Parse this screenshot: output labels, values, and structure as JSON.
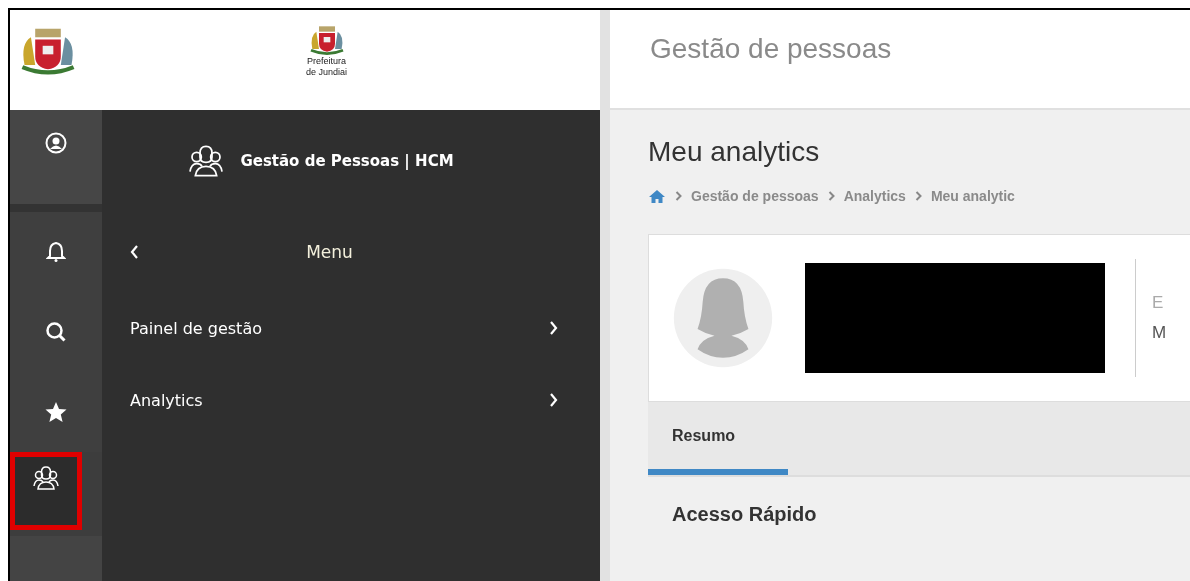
{
  "header": {
    "logo_lines": [
      "Prefeitura",
      "de Jundiai"
    ],
    "page_title": "Gestão de pessoas"
  },
  "rail": [
    {
      "kind": "user",
      "selected": false,
      "highlighted": false
    },
    {
      "kind": "bell",
      "selected": false,
      "highlighted": false
    },
    {
      "kind": "search",
      "selected": false,
      "highlighted": false
    },
    {
      "kind": "star",
      "selected": false,
      "highlighted": false
    },
    {
      "kind": "people",
      "selected": true,
      "highlighted": true
    }
  ],
  "menu": {
    "title": "Gestão de Pessoas | HCM",
    "heading": "Menu",
    "items": [
      {
        "label": "Painel de gestão"
      },
      {
        "label": "Analytics"
      }
    ]
  },
  "main": {
    "title": "Meu analytics",
    "breadcrumb": [
      "Gestão de pessoas",
      "Analytics",
      "Meu analytic"
    ],
    "profile": {
      "side_lines": [
        "E",
        "M"
      ]
    },
    "tabs": [
      {
        "label": "Resumo",
        "selected": true
      }
    ],
    "section_title": "Acesso Rápido"
  }
}
